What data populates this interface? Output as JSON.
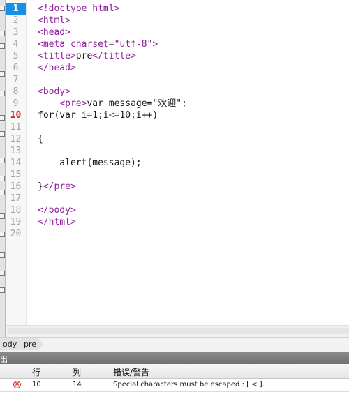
{
  "editor": {
    "current_line": "1",
    "error_line": "10",
    "line_numbers": [
      "1",
      "2",
      "3",
      "4",
      "5",
      "6",
      "7",
      "8",
      "9",
      "10",
      "11",
      "12",
      "13",
      "14",
      "15",
      "16",
      "17",
      "18",
      "19",
      "20"
    ],
    "lines": [
      [
        {
          "t": "tag",
          "v": "<!doctype"
        },
        {
          "t": "",
          "v": " "
        },
        {
          "t": "attr",
          "v": "html"
        },
        {
          "t": "tag",
          "v": ">"
        }
      ],
      [
        {
          "t": "tag",
          "v": "<html>"
        }
      ],
      [
        {
          "t": "tag",
          "v": "<head>"
        }
      ],
      [
        {
          "t": "tag",
          "v": "<meta"
        },
        {
          "t": "",
          "v": " "
        },
        {
          "t": "attr",
          "v": "charset"
        },
        {
          "t": "",
          "v": "="
        },
        {
          "t": "attr",
          "v": "\"utf-8\""
        },
        {
          "t": "tag",
          "v": ">"
        }
      ],
      [
        {
          "t": "tag",
          "v": "<title>"
        },
        {
          "t": "",
          "v": "pre"
        },
        {
          "t": "tag",
          "v": "</title>"
        }
      ],
      [
        {
          "t": "tag",
          "v": "</head>"
        }
      ],
      [],
      [
        {
          "t": "tag",
          "v": "<body>"
        }
      ],
      [
        {
          "t": "",
          "v": "    "
        },
        {
          "t": "tag",
          "v": "<pre>"
        },
        {
          "t": "",
          "v": "var message=\"欢迎\";"
        }
      ],
      [
        {
          "t": "",
          "v": "for(var i=1;i"
        },
        {
          "t": "tag",
          "v": "<"
        },
        {
          "t": "",
          "v": "=10;i++)"
        }
      ],
      [],
      [
        {
          "t": "",
          "v": "{"
        }
      ],
      [],
      [
        {
          "t": "",
          "v": "    alert(message);"
        }
      ],
      [],
      [
        {
          "t": "",
          "v": "}"
        },
        {
          "t": "tag",
          "v": "</pre>"
        }
      ],
      [],
      [
        {
          "t": "tag",
          "v": "</body>"
        }
      ],
      [
        {
          "t": "tag",
          "v": "</html>"
        }
      ],
      []
    ]
  },
  "breadcrumb": {
    "items": [
      "ody",
      "pre"
    ]
  },
  "output": {
    "title": "出",
    "columns": {
      "line": "行",
      "column": "列",
      "message": "错误/警告"
    },
    "rows": [
      {
        "icon": "error-icon",
        "line": "10",
        "column": "14",
        "message": "Special characters must be escaped : [ < ]."
      }
    ]
  },
  "colors": {
    "tag": "#8e1f9c",
    "current_line_bg": "#1a8fe8",
    "error_line": "#d11f1f"
  }
}
